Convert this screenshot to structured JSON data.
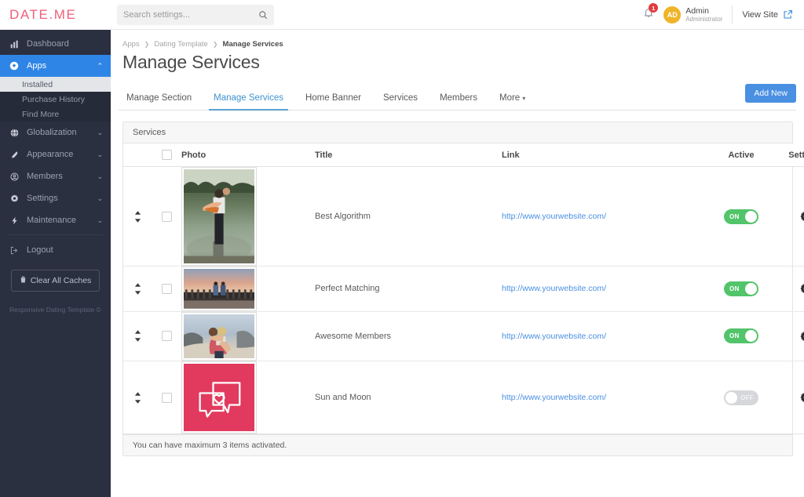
{
  "brand": {
    "name": "DATE.ME",
    "color": "#ef5f7a"
  },
  "sidebar": {
    "items": [
      {
        "label": "Dashboard",
        "icon": "bar-chart-icon",
        "caret": ""
      },
      {
        "label": "Apps",
        "icon": "apps-icon",
        "caret": "⌃"
      },
      {
        "label": "Globalization",
        "icon": "globe-icon",
        "caret": "⌄"
      },
      {
        "label": "Appearance",
        "icon": "brush-icon",
        "caret": "⌄"
      },
      {
        "label": "Members",
        "icon": "user-circle-icon",
        "caret": "⌄"
      },
      {
        "label": "Settings",
        "icon": "gear-icon",
        "caret": "⌄"
      },
      {
        "label": "Maintenance",
        "icon": "bolt-icon",
        "caret": "⌄"
      }
    ],
    "subitems": [
      {
        "label": "Installed"
      },
      {
        "label": "Purchase History"
      },
      {
        "label": "Find More"
      }
    ],
    "logout": "Logout",
    "clear_caches": "Clear All Caches",
    "footer": "Responsive Dating Template ©",
    "active_color": "#2e85e6",
    "bg_color": "#2b3041"
  },
  "topbar": {
    "search_placeholder": "Search settings...",
    "search_value": "",
    "notifications_count": "1",
    "user": {
      "initials": "AD",
      "name": "Admin",
      "role": "Administrator",
      "avatar_color": "#f0b429"
    },
    "view_site": "View Site"
  },
  "breadcrumb": [
    {
      "label": "Apps",
      "current": false
    },
    {
      "label": "Dating Template",
      "current": false
    },
    {
      "label": "Manage Services",
      "current": true
    }
  ],
  "breadcrumb_sep": "❯",
  "page_title": "Manage Services",
  "tabs": [
    {
      "label": "Manage Section",
      "active": false,
      "caret": ""
    },
    {
      "label": "Manage Services",
      "active": true,
      "caret": ""
    },
    {
      "label": "Home Banner",
      "active": false,
      "caret": ""
    },
    {
      "label": "Services",
      "active": false,
      "caret": ""
    },
    {
      "label": "Members",
      "active": false,
      "caret": ""
    },
    {
      "label": "More",
      "active": false,
      "caret": "▾"
    }
  ],
  "add_new_label": "Add New",
  "panel": {
    "heading": "Services",
    "columns": [
      "Photo",
      "Title",
      "Link",
      "Active",
      "Settings"
    ],
    "rows": [
      {
        "title": "Best Algorithm",
        "link": "http://www.yourwebsite.com/",
        "active": true,
        "active_label": "ON",
        "photo": "couple-lake-photo",
        "photo_h": 128
      },
      {
        "title": "Perfect Matching",
        "link": "http://www.yourwebsite.com/",
        "active": true,
        "active_label": "ON",
        "photo": "couple-bench-photo",
        "photo_h": 54
      },
      {
        "title": "Awesome Members",
        "link": "http://www.yourwebsite.com/",
        "active": true,
        "active_label": "ON",
        "photo": "couple-embrace-photo",
        "photo_h": 60
      },
      {
        "title": "Sun and Moon",
        "link": "http://www.yourwebsite.com/",
        "active": false,
        "active_label": "OFF",
        "photo": "chat-heart-icon-pink",
        "photo_h": 92
      }
    ],
    "footer_note": "You can have maximum 3 items activated."
  },
  "colors": {
    "accent_blue": "#4a90e2",
    "toggle_on": "#52c46a",
    "toggle_off": "#d5d7da",
    "pink": "#e23a5e",
    "link": "#4a90e2"
  }
}
